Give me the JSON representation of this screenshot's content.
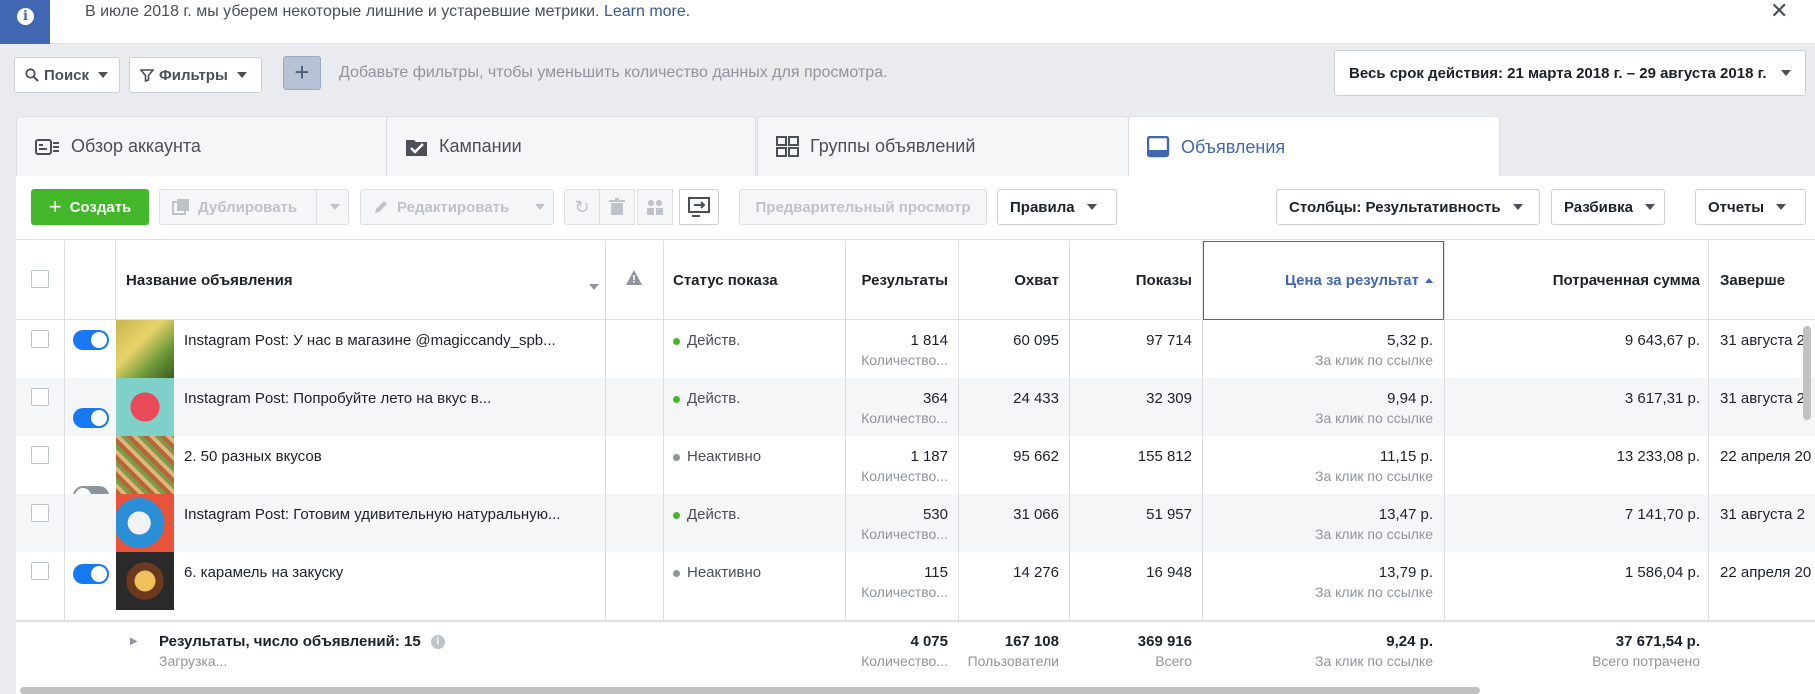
{
  "notice": {
    "text": "В июле 2018 г. мы уберем некоторые лишние и устаревшие метрики.",
    "link": "Learn more.",
    "close": "✕"
  },
  "filterbar": {
    "search_label": "Поиск",
    "filters_label": "Фильтры",
    "add": "+",
    "hint": "Добавьте фильтры, чтобы уменьшить количество данных для просмотра.",
    "date_range": "Весь срок действия: 21 марта 2018 г. – 29 августа 2018 г."
  },
  "tabs": [
    {
      "label": "Обзор аккаунта",
      "icon": "account-overview-icon"
    },
    {
      "label": "Кампании",
      "icon": "campaigns-folder-icon"
    },
    {
      "label": "Группы объявлений",
      "icon": "ad-sets-grid-icon"
    },
    {
      "label": "Объявления",
      "icon": "ads-icon",
      "active": true
    }
  ],
  "toolbar": {
    "create": "Создать",
    "duplicate": "Дублировать",
    "edit": "Редактировать",
    "preview": "Предварительный просмотр",
    "rules": "Правила",
    "columns": "Столбцы: Результативность",
    "breakdown": "Разбивка",
    "reports": "Отчеты"
  },
  "table": {
    "headers": {
      "name": "Название объявления",
      "status": "Статус показа",
      "results": "Результаты",
      "reach": "Охват",
      "impressions": "Показы",
      "cost": "Цена за результат",
      "spent": "Потраченная сумма",
      "end": "Заверше"
    },
    "rows": [
      {
        "on": true,
        "name": "Instagram Post: У нас в магазине @magiccandy_spb...",
        "status": "Действ.",
        "active": true,
        "results": "1 814",
        "results_sub": "Количество...",
        "reach": "60 095",
        "impressions": "97 714",
        "cost": "5,32 р.",
        "cost_sub": "За клик по ссылке",
        "spent": "9 643,67 р.",
        "end": "31 августа 2"
      },
      {
        "on": true,
        "name": "Instagram Post: Попробуйте лето на вкус в...",
        "status": "Действ.",
        "active": true,
        "results": "364",
        "results_sub": "Количество...",
        "reach": "24 433",
        "impressions": "32 309",
        "cost": "9,94 р.",
        "cost_sub": "За клик по ссылке",
        "spent": "3 617,31 р.",
        "end": "31 августа 2"
      },
      {
        "on": false,
        "name": "2. 50 разных вкусов",
        "status": "Неактивно",
        "active": false,
        "results": "1 187",
        "results_sub": "Количество...",
        "reach": "95 662",
        "impressions": "155 812",
        "cost": "11,15 р.",
        "cost_sub": "За клик по ссылке",
        "spent": "13 233,08 р.",
        "end": "22 апреля 20"
      },
      {
        "on": true,
        "name": "Instagram Post: Готовим удивительную натуральную...",
        "status": "Действ.",
        "active": true,
        "results": "530",
        "results_sub": "Количество...",
        "reach": "31 066",
        "impressions": "51 957",
        "cost": "13,47 р.",
        "cost_sub": "За клик по ссылке",
        "spent": "7 141,70 р.",
        "end": "31 августа 2"
      },
      {
        "on": false,
        "name": "6. карамель на закуску",
        "status": "Неактивно",
        "active": false,
        "results": "115",
        "results_sub": "Количество...",
        "reach": "14 276",
        "impressions": "16 948",
        "cost": "13,79 р.",
        "cost_sub": "За клик по ссылке",
        "spent": "1 586,04 р.",
        "end": "22 апреля 20"
      }
    ],
    "footer": {
      "title": "Результаты, число объявлений: 15",
      "loading": "Загрузка...",
      "results": "4 075",
      "results_sub": "Количество...",
      "reach": "167 108",
      "reach_sub": "Пользователи",
      "impressions": "369 916",
      "impressions_sub": "Всего",
      "cost": "9,24 р.",
      "cost_sub": "За клик по ссылке",
      "spent": "37 671,54 р.",
      "spent_sub": "Всего потрачено"
    }
  },
  "colors": {
    "accent": "#4267b2",
    "create": "#42b72a",
    "active_dot": "#42b72a",
    "inactive_dot": "#8d949e",
    "toggle_on": "#1877f2"
  }
}
